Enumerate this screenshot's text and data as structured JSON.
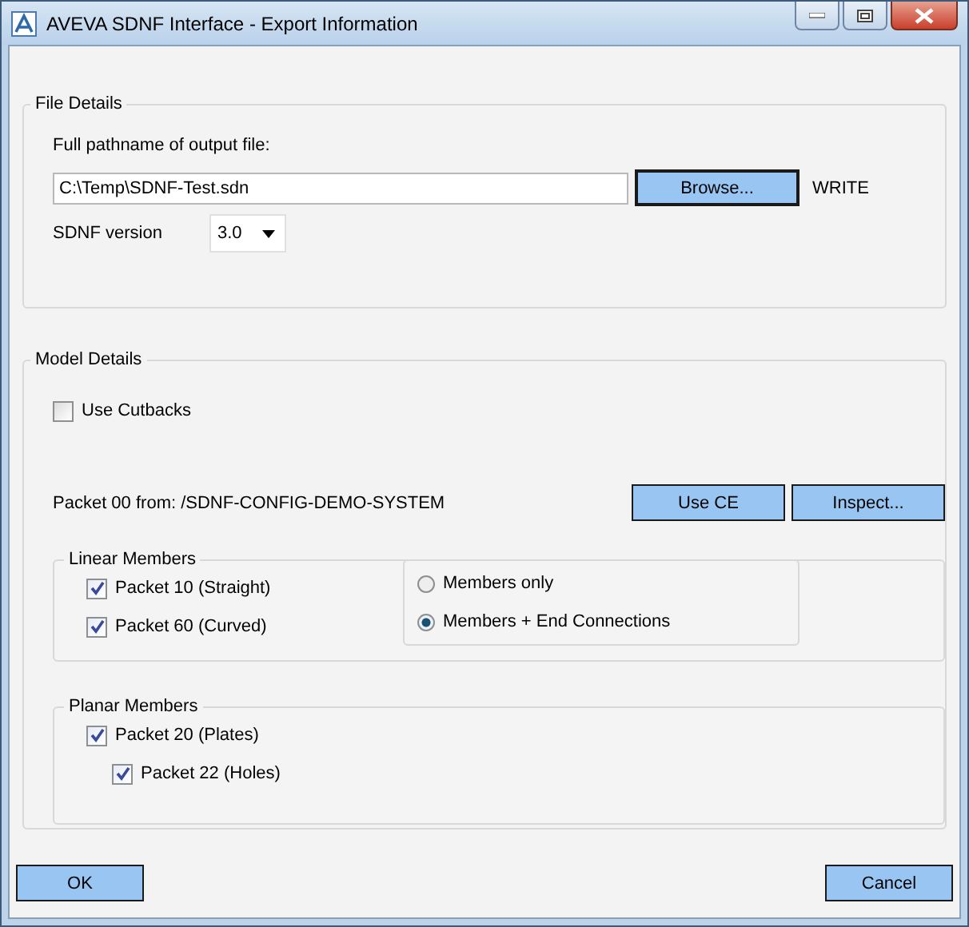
{
  "window": {
    "title": "AVEVA SDNF Interface - Export Information"
  },
  "file_details": {
    "legend": "File Details",
    "path_label": "Full pathname of output file:",
    "path_value": "C:\\Temp\\SDNF-Test.sdn",
    "browse_button": "Browse...",
    "mode": "WRITE",
    "version_label": "SDNF version",
    "version_value": "3.0"
  },
  "model_details": {
    "legend": "Model Details",
    "use_cutbacks": {
      "label": "Use Cutbacks",
      "checked": false
    },
    "packet_text": "Packet 00 from: /SDNF-CONFIG-DEMO-SYSTEM",
    "buttons": [
      "Use CE",
      "Inspect..."
    ],
    "linear_members": {
      "legend": "Linear Members",
      "packets": [
        {
          "label": "Packet 10 (Straight)",
          "checked": true
        },
        {
          "label": "Packet 60 (Curved)",
          "checked": true
        }
      ],
      "options": [
        {
          "label": "Members only",
          "selected": false
        },
        {
          "label": "Members + End Connections",
          "selected": true
        }
      ]
    },
    "planar_members": {
      "legend": "Planar Members",
      "packets": [
        {
          "label": "Packet 20 (Plates)",
          "checked": true,
          "children": [
            {
              "label": "Packet 22 (Holes)",
              "checked": true
            }
          ]
        }
      ]
    }
  },
  "buttons": [
    "OK",
    "Cancel"
  ]
}
